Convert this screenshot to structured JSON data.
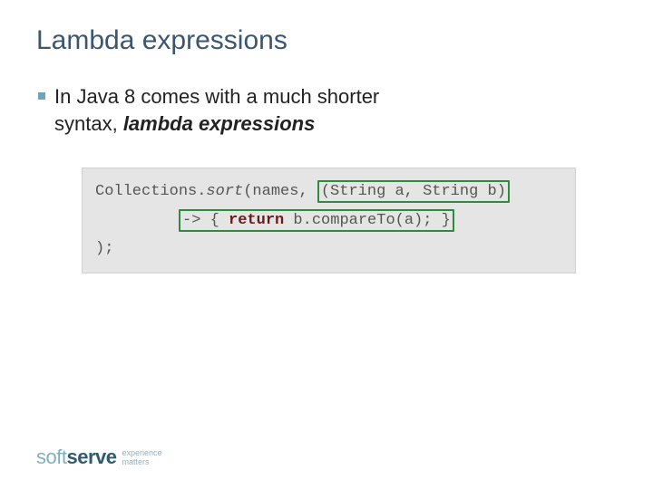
{
  "title": "Lambda expressions",
  "bullet": {
    "prefix": "In Java 8 comes with a much shorter syntax, ",
    "emphasis": "lambda expressions"
  },
  "code": {
    "l1a": "Collections.",
    "l1b": "sort",
    "l1c": "(names, ",
    "l1d": "(String a, String b)",
    "l2a": "-> { ",
    "l2kw": "return",
    "l2b": " b.compareTo(a); }",
    "l3": ");"
  },
  "logo": {
    "soft": "soft",
    "serve": "serve",
    "tag1": "experience",
    "tag2": "matters"
  }
}
